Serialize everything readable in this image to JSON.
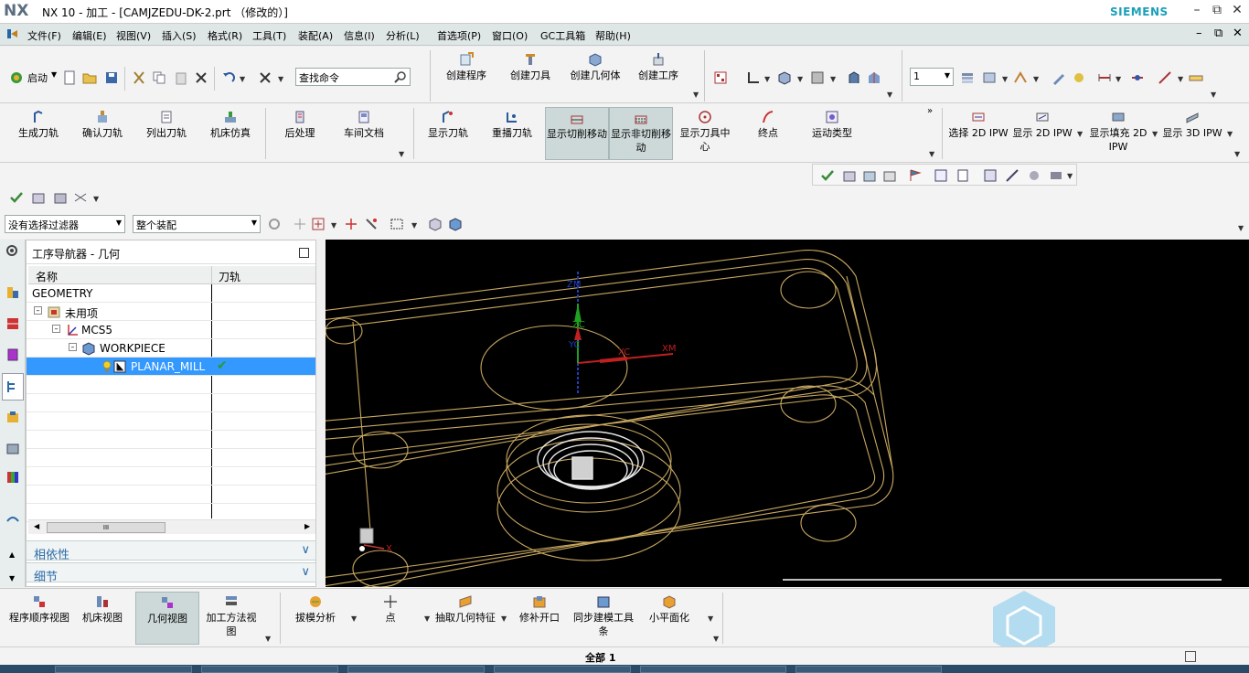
{
  "app": {
    "logo": "NX",
    "title": "NX 10 - 加工 - [CAMJZEDU-DK-2.prt （修改的）]",
    "brand": "SIEMENS"
  },
  "menu": [
    "文件(F)",
    "编辑(E)",
    "视图(V)",
    "插入(S)",
    "格式(R)",
    "工具(T)",
    "装配(A)",
    "信息(I)",
    "分析(L)",
    "首选项(P)",
    "窗口(O)",
    "GC工具箱",
    "帮助(H)"
  ],
  "toolbar1": {
    "start_label": "启动",
    "search_placeholder": "查找命令",
    "create_buttons": [
      "创建程序",
      "创建刀具",
      "创建几何体",
      "创建工序"
    ],
    "layer_value": "1"
  },
  "toolbar2": {
    "buttons": [
      "生成刀轨",
      "确认刀轨",
      "列出刀轨",
      "机床仿真",
      "后处理",
      "车间文档",
      "显示刀轨",
      "重播刀轨",
      "显示切削移动",
      "显示非切削移动",
      "显示刀具中心",
      "终点",
      "运动类型",
      "选择 2D IPW",
      "显示 2D IPW",
      "显示填充 2D IPW",
      "显示 3D IPW"
    ]
  },
  "filterbar": {
    "filter_value": "没有选择过滤器",
    "scope_value": "整个装配"
  },
  "navigator": {
    "title": "工序导航器 - 几何",
    "col_name": "名称",
    "col_path": "刀轨",
    "rows": [
      {
        "label": "GEOMETRY"
      },
      {
        "label": "未用项"
      },
      {
        "label": "MCS5"
      },
      {
        "label": "WORKPIECE"
      },
      {
        "label": "PLANAR_MILL",
        "status": "✔"
      }
    ],
    "panels": [
      "相依性",
      "细节"
    ]
  },
  "viewport": {
    "axis_labels": [
      "ZM",
      "ZC",
      "YC",
      "XC",
      "XM",
      "X"
    ]
  },
  "bottombar": {
    "view_buttons": [
      "程序顺序视图",
      "机床视图",
      "几何视图",
      "加工方法视图"
    ],
    "tool_buttons": [
      "拔模分析",
      "点",
      "抽取几何特征",
      "修补开口",
      "同步建模工具条",
      "小平面化"
    ]
  },
  "status": {
    "text": "全部 1"
  },
  "colors": {
    "accent": "#3399ff",
    "selected_button": "#cdd9d8",
    "panel_link": "#2a6aa8",
    "wireframe": "#c8a860"
  }
}
